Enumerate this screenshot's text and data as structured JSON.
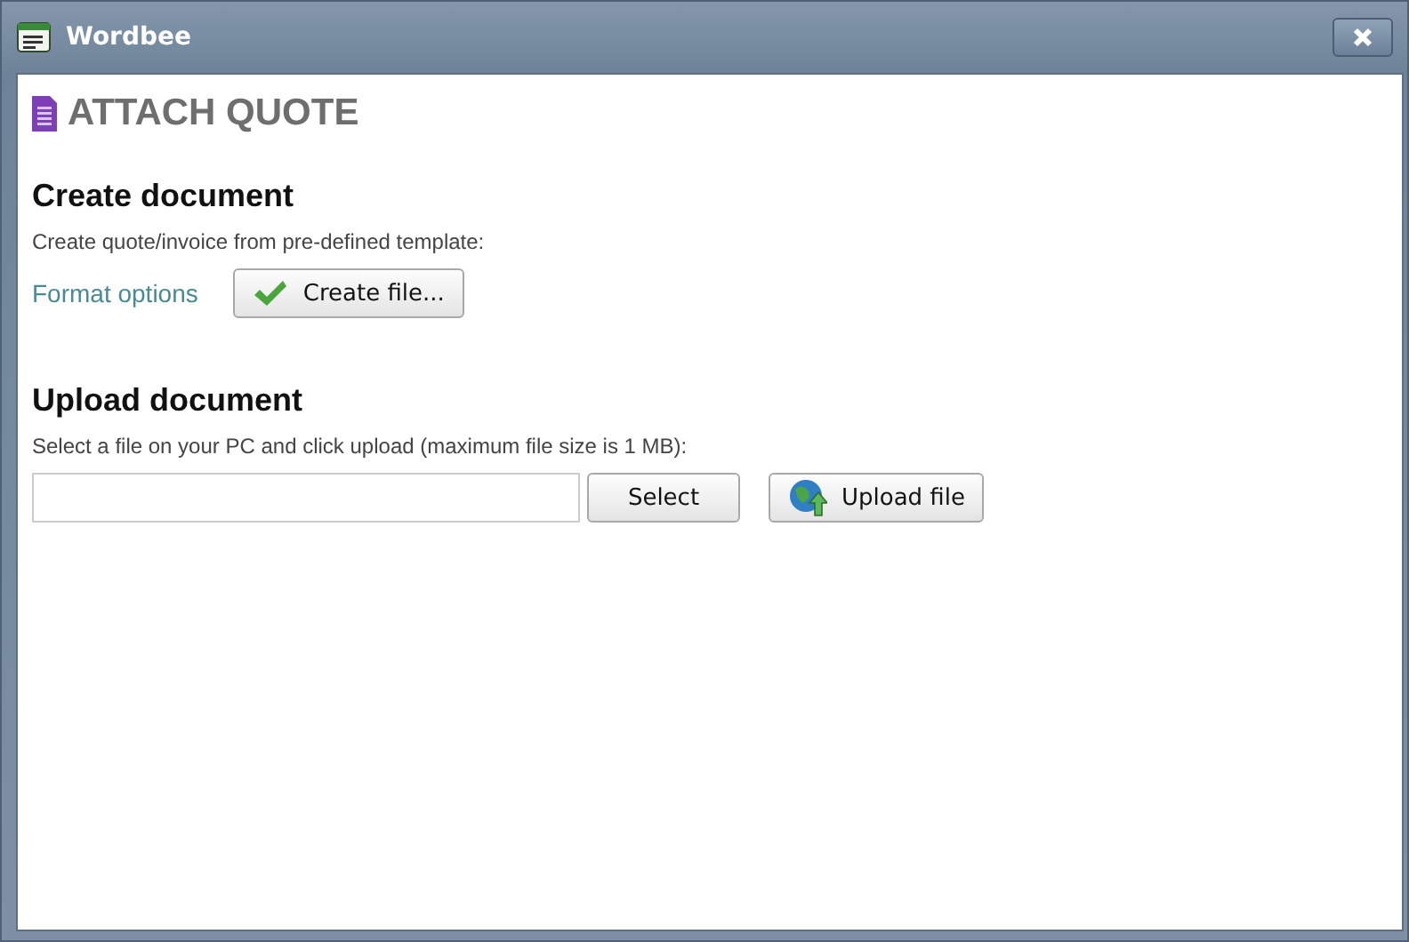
{
  "window": {
    "title": "Wordbee"
  },
  "page_title": "ATTACH QUOTE",
  "create": {
    "heading": "Create document",
    "description": "Create quote/invoice from pre-defined template:",
    "link": "Format options",
    "button": "Create file..."
  },
  "upload": {
    "heading": "Upload document",
    "description": "Select a file on your PC and click upload (maximum file size is 1 MB):",
    "select_button": "Select",
    "upload_button": "Upload file"
  }
}
